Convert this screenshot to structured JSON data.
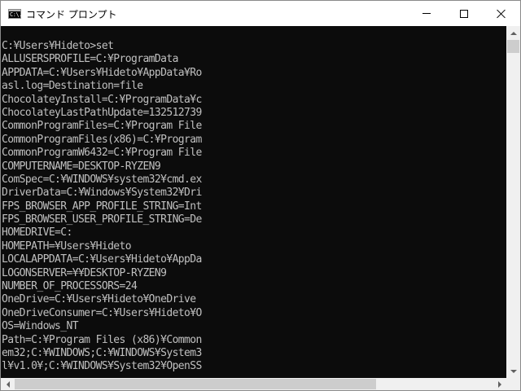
{
  "window": {
    "title": "コマンド プロンプト",
    "icon": "console-app-icon",
    "icon_text": "C:\\."
  },
  "caption_buttons": {
    "minimize": "minimize-icon",
    "maximize": "maximize-icon",
    "close": "close-icon"
  },
  "console": {
    "lines": [
      "C:¥Users¥Hideto>set",
      "ALLUSERSPROFILE=C:¥ProgramData",
      "APPDATA=C:¥Users¥Hideto¥AppData¥Ro",
      "asl.log=Destination=file",
      "ChocolateyInstall=C:¥ProgramData¥c",
      "ChocolateyLastPathUpdate=132512739",
      "CommonProgramFiles=C:¥Program File",
      "CommonProgramFiles(x86)=C:¥Program",
      "CommonProgramW6432=C:¥Program File",
      "COMPUTERNAME=DESKTOP-RYZEN9",
      "ComSpec=C:¥WINDOWS¥system32¥cmd.ex",
      "DriverData=C:¥Windows¥System32¥Dri",
      "FPS_BROWSER_APP_PROFILE_STRING=Int",
      "FPS_BROWSER_USER_PROFILE_STRING=De",
      "HOMEDRIVE=C:",
      "HOMEPATH=¥Users¥Hideto",
      "LOCALAPPDATA=C:¥Users¥Hideto¥AppDa",
      "LOGONSERVER=¥¥DESKTOP-RYZEN9",
      "NUMBER_OF_PROCESSORS=24",
      "OneDrive=C:¥Users¥Hideto¥OneDrive",
      "OneDriveConsumer=C:¥Users¥Hideto¥O",
      "OS=Windows_NT",
      "Path=C:¥Program Files (x86)¥Common",
      "em32;C:¥WINDOWS;C:¥WINDOWS¥System3",
      "l¥v1.0¥;C:¥WINDOWS¥System32¥OpenSS"
    ]
  },
  "scrollbars": {
    "vertical_position": 0.0,
    "horizontal_position": 0.0,
    "up_arrow": "scroll-up-arrow-icon",
    "down_arrow": "scroll-down-arrow-icon",
    "left_arrow": "scroll-left-arrow-icon",
    "right_arrow": "scroll-right-arrow-icon"
  },
  "colors": {
    "console_background": "#0c0c0c",
    "console_text": "#c0c0c0",
    "titlebar_background": "#ffffff",
    "scrollbar_track": "#f0f0f0",
    "scrollbar_thumb": "#cdcdcd"
  }
}
